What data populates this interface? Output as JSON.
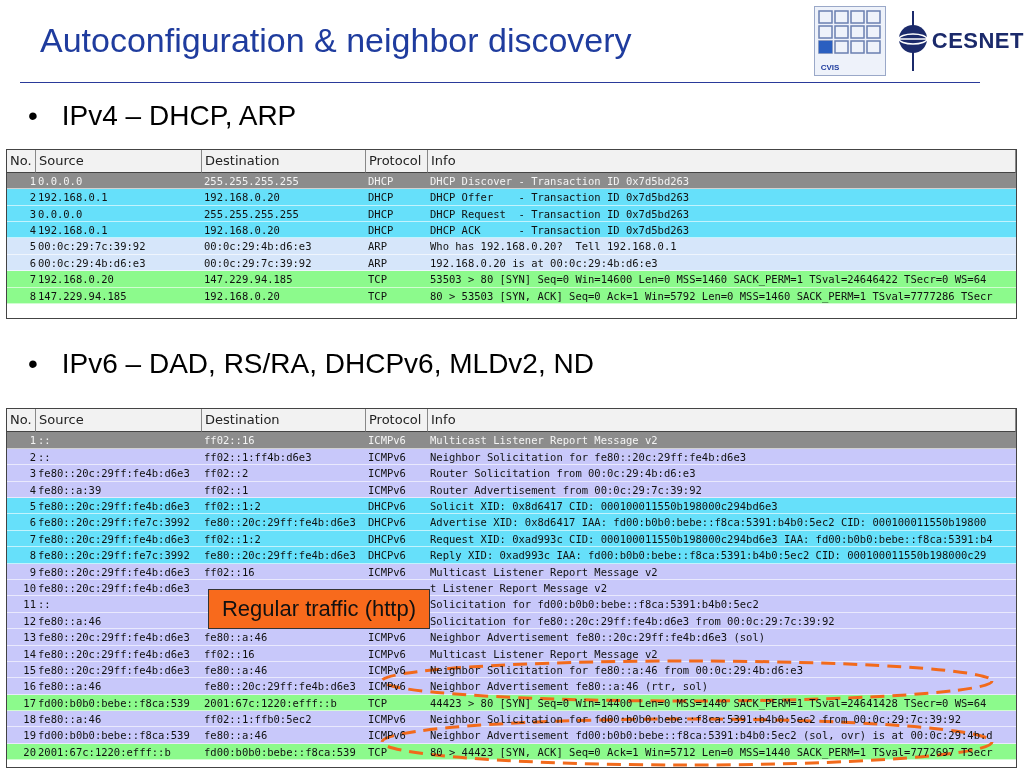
{
  "slide": {
    "title": "Autoconfiguration & neighbor discovery",
    "logos": [
      {
        "kind": "cvis",
        "text": "CVIS"
      },
      {
        "kind": "cesnet",
        "text": "CESNET"
      }
    ]
  },
  "sections": [
    {
      "bullet": "•",
      "heading": "IPv4 – DHCP, ARP",
      "table": {
        "columns": [
          "No.",
          "Source",
          "Destination",
          "Protocol",
          "Info"
        ],
        "rows": [
          {
            "no": "1",
            "source": "0.0.0.0",
            "destination": "255.255.255.255",
            "protocol": "DHCP",
            "info": "DHCP Discover - Transaction ID 0x7d5bd263",
            "color": "#8c8c8c",
            "selected": true
          },
          {
            "no": "2",
            "source": "192.168.0.1",
            "destination": "192.168.0.20",
            "protocol": "DHCP",
            "info": "DHCP Offer    - Transaction ID 0x7d5bd263",
            "color": "#66e0fa",
            "selected": false
          },
          {
            "no": "3",
            "source": "0.0.0.0",
            "destination": "255.255.255.255",
            "protocol": "DHCP",
            "info": "DHCP Request  - Transaction ID 0x7d5bd263",
            "color": "#66e0fa",
            "selected": false
          },
          {
            "no": "4",
            "source": "192.168.0.1",
            "destination": "192.168.0.20",
            "protocol": "DHCP",
            "info": "DHCP ACK      - Transaction ID 0x7d5bd263",
            "color": "#66e0fa",
            "selected": false
          },
          {
            "no": "5",
            "source": "00:0c:29:7c:39:92",
            "destination": "00:0c:29:4b:d6:e3",
            "protocol": "ARP",
            "info": "Who has 192.168.0.20?  Tell 192.168.0.1",
            "color": "#d6e6fa",
            "selected": false
          },
          {
            "no": "6",
            "source": "00:0c:29:4b:d6:e3",
            "destination": "00:0c:29:7c:39:92",
            "protocol": "ARP",
            "info": "192.168.0.20 is at 00:0c:29:4b:d6:e3",
            "color": "#d6e6fa",
            "selected": false
          },
          {
            "no": "7",
            "source": "192.168.0.20",
            "destination": "147.229.94.185",
            "protocol": "TCP",
            "info": "53503 > 80 [SYN] Seq=0 Win=14600 Len=0 MSS=1460 SACK_PERM=1 TSval=24646422 TSecr=0 WS=64",
            "color": "#8cfa8c",
            "selected": false
          },
          {
            "no": "8",
            "source": "147.229.94.185",
            "destination": "192.168.0.20",
            "protocol": "TCP",
            "info": "80 > 53503 [SYN, ACK] Seq=0 Ack=1 Win=5792 Len=0 MSS=1460 SACK_PERM=1 TSval=7777286 TSecr",
            "color": "#8cfa8c",
            "selected": false
          }
        ]
      }
    },
    {
      "bullet": "•",
      "heading": "IPv6 – DAD, RS/RA, DHCPv6, MLDv2, ND",
      "callout": "Regular traffic (http)",
      "table": {
        "columns": [
          "No.",
          "Source",
          "Destination",
          "Protocol",
          "Info"
        ],
        "rows": [
          {
            "no": "1",
            "source": "::",
            "destination": "ff02::16",
            "protocol": "ICMPv6",
            "info": "Multicast Listener Report Message v2",
            "color": "#8c8c8c",
            "selected": true
          },
          {
            "no": "2",
            "source": "::",
            "destination": "ff02::1:ff4b:d6e3",
            "protocol": "ICMPv6",
            "info": "Neighbor Solicitation for fe80::20c:29ff:fe4b:d6e3",
            "color": "#c8c8fa",
            "selected": false
          },
          {
            "no": "3",
            "source": "fe80::20c:29ff:fe4b:d6e3",
            "destination": "ff02::2",
            "protocol": "ICMPv6",
            "info": "Router Solicitation from 00:0c:29:4b:d6:e3",
            "color": "#c8c8fa",
            "selected": false
          },
          {
            "no": "4",
            "source": "fe80::a:39",
            "destination": "ff02::1",
            "protocol": "ICMPv6",
            "info": "Router Advertisement from 00:0c:29:7c:39:92",
            "color": "#c8c8fa",
            "selected": false
          },
          {
            "no": "5",
            "source": "fe80::20c:29ff:fe4b:d6e3",
            "destination": "ff02::1:2",
            "protocol": "DHCPv6",
            "info": "Solicit XID: 0x8d6417 CID: 000100011550b198000c294bd6e3",
            "color": "#66e0fa",
            "selected": false
          },
          {
            "no": "6",
            "source": "fe80::20c:29ff:fe7c:3992",
            "destination": "fe80::20c:29ff:fe4b:d6e3",
            "protocol": "DHCPv6",
            "info": "Advertise XID: 0x8d6417 IAA: fd00:b0b0:bebe::f8ca:5391:b4b0:5ec2 CID: 000100011550b19800",
            "color": "#66e0fa",
            "selected": false
          },
          {
            "no": "7",
            "source": "fe80::20c:29ff:fe4b:d6e3",
            "destination": "ff02::1:2",
            "protocol": "DHCPv6",
            "info": "Request XID: 0xad993c CID: 000100011550b198000c294bd6e3 IAA: fd00:b0b0:bebe::f8ca:5391:b4",
            "color": "#66e0fa",
            "selected": false
          },
          {
            "no": "8",
            "source": "fe80::20c:29ff:fe7c:3992",
            "destination": "fe80::20c:29ff:fe4b:d6e3",
            "protocol": "DHCPv6",
            "info": "Reply XID: 0xad993c IAA: fd00:b0b0:bebe::f8ca:5391:b4b0:5ec2 CID: 000100011550b198000c29",
            "color": "#66e0fa",
            "selected": false
          },
          {
            "no": "9",
            "source": "fe80::20c:29ff:fe4b:d6e3",
            "destination": "ff02::16",
            "protocol": "ICMPv6",
            "info": "Multicast Listener Report Message v2",
            "color": "#c8c8fa",
            "selected": false
          },
          {
            "no": "10",
            "source": "fe80::20c:29ff:fe4b:d6e3",
            "info": "t Listener Report Message v2",
            "color": "#c8c8fa",
            "selected": false
          },
          {
            "no": "11",
            "source": "::",
            "info": "Solicitation for fd00:b0b0:bebe::f8ca:5391:b4b0:5ec2",
            "color": "#c8c8fa",
            "selected": false
          },
          {
            "no": "12",
            "source": "fe80::a:46",
            "info": "Solicitation for fe80::20c:29ff:fe4b:d6e3 from 00:0c:29:7c:39:92",
            "color": "#c8c8fa",
            "selected": false
          },
          {
            "no": "13",
            "source": "fe80::20c:29ff:fe4b:d6e3",
            "destination": "fe80::a:46",
            "protocol": "ICMPv6",
            "info": "Neighbor Advertisement fe80::20c:29ff:fe4b:d6e3 (sol)",
            "color": "#c8c8fa",
            "selected": false
          },
          {
            "no": "14",
            "source": "fe80::20c:29ff:fe4b:d6e3",
            "destination": "ff02::16",
            "protocol": "ICMPv6",
            "info": "Multicast Listener Report Message v2",
            "color": "#c8c8fa",
            "selected": false
          },
          {
            "no": "15",
            "source": "fe80::20c:29ff:fe4b:d6e3",
            "destination": "fe80::a:46",
            "protocol": "ICMPv6",
            "info": "Neighbor Solicitation for fe80::a:46 from 00:0c:29:4b:d6:e3",
            "color": "#c8c8fa",
            "selected": false
          },
          {
            "no": "16",
            "source": "fe80::a:46",
            "destination": "fe80::20c:29ff:fe4b:d6e3",
            "protocol": "ICMPv6",
            "info": "Neighbor Advertisement fe80::a:46 (rtr, sol)",
            "color": "#c8c8fa",
            "selected": false
          },
          {
            "no": "17",
            "source": "fd00:b0b0:bebe::f8ca:539",
            "destination": "2001:67c:1220:efff::b",
            "protocol": "TCP",
            "info": "44423 > 80 [SYN] Seq=0 Win=14400 Len=0 MSS=1440 SACK_PERM=1 TSval=24641428 TSecr=0 WS=64",
            "color": "#8cfa8c",
            "selected": false
          },
          {
            "no": "18",
            "source": "fe80::a:46",
            "destination": "ff02::1:ffb0:5ec2",
            "protocol": "ICMPv6",
            "info": "Neighbor Solicitation for fd00:b0b0:bebe::f8ca:5391:b4b0:5ec2 from 00:0c:29:7c:39:92",
            "color": "#c8c8fa",
            "selected": false
          },
          {
            "no": "19",
            "source": "fd00:b0b0:bebe::f8ca:539",
            "destination": "fe80::a:46",
            "protocol": "ICMPv6",
            "info": "Neighbor Advertisement fd00:b0b0:bebe::f8ca:5391:b4b0:5ec2 (sol, ovr) is at 00:0c:29:4b:d",
            "color": "#c8c8fa",
            "selected": false
          },
          {
            "no": "20",
            "source": "2001:67c:1220:efff::b",
            "destination": "fd00:b0b0:bebe::f8ca:539",
            "protocol": "TCP",
            "info": "80 > 44423 [SYN, ACK] Seq=0 Ack=1 Win=5712 Len=0 MSS=1440 SACK_PERM=1 TSval=7772697 TSecr",
            "color": "#8cfa8c",
            "selected": false
          }
        ]
      }
    }
  ]
}
